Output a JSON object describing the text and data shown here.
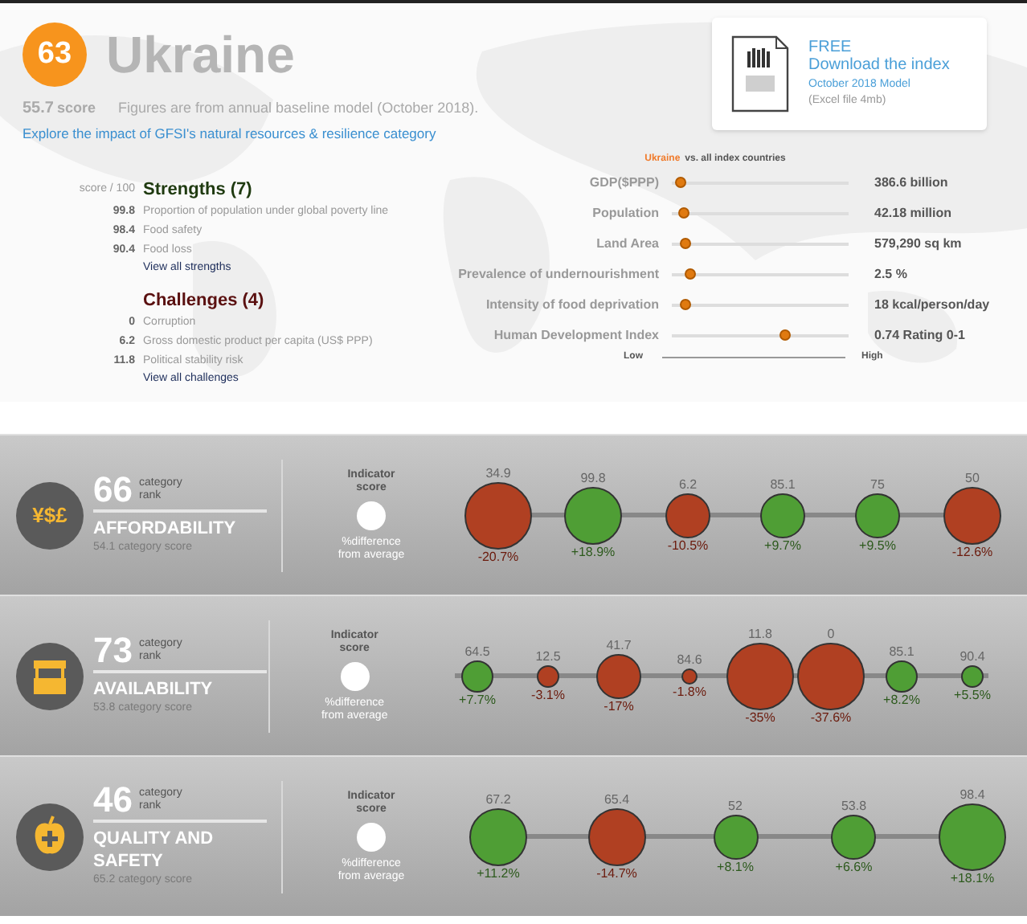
{
  "header": {
    "rank": "63",
    "country": "Ukraine",
    "score": "55.7",
    "score_label": "score",
    "note": "Figures are from annual baseline model (October 2018).",
    "explore_link": "Explore the impact of GFSI's natural resources & resilience category"
  },
  "download": {
    "free": "FREE",
    "title": "Download the index",
    "model": "October 2018 Model",
    "file": "(Excel file 4mb)"
  },
  "strengths": {
    "scale_label": "score / 100",
    "title": "Strengths (7)",
    "items": [
      {
        "score": "99.8",
        "label": "Proportion of population under global poverty line"
      },
      {
        "score": "98.4",
        "label": "Food safety"
      },
      {
        "score": "90.4",
        "label": "Food loss"
      }
    ],
    "link": "View all strengths"
  },
  "challenges": {
    "title": "Challenges (4)",
    "items": [
      {
        "score": "0",
        "label": "Corruption"
      },
      {
        "score": "6.2",
        "label": "Gross domestic product per capita (US$ PPP)"
      },
      {
        "score": "11.8",
        "label": "Political stability risk"
      }
    ],
    "link": "View all challenges"
  },
  "comparison": {
    "legend_country": "Ukraine",
    "legend_rest": "vs. all index countries",
    "rows": [
      {
        "label": "GDP($PPP)",
        "level": 0.02,
        "value": "386.6 billion"
      },
      {
        "label": "Population",
        "level": 0.04,
        "value": "42.18 million"
      },
      {
        "label": "Land Area",
        "level": 0.05,
        "value": "579,290 sq km"
      },
      {
        "label": "Prevalence of undernourishment",
        "level": 0.08,
        "value": "2.5 %"
      },
      {
        "label": "Intensity of food deprivation",
        "level": 0.05,
        "value": "18 kcal/person/day"
      },
      {
        "label": "Human Development Index",
        "level": 0.65,
        "value": "0.74 Rating 0-1"
      }
    ],
    "low": "Low",
    "high": "High"
  },
  "categories": [
    {
      "kind": "currency",
      "glyphs": "¥$£",
      "rank": "66",
      "rank_label": "category rank",
      "name": "AFFORDABILITY",
      "score_text": "54.1 category score",
      "indicator_label": "Indicator score",
      "diff_label": "%difference from average",
      "bubbles": [
        {
          "score": "34.9",
          "diff": "-20.7%",
          "kind": "giant",
          "color": "#b04022"
        },
        {
          "score": "99.8",
          "diff": "+18.9%",
          "kind": "huge",
          "color": "#4f9e35"
        },
        {
          "score": "6.2",
          "diff": "-10.5%",
          "kind": "large",
          "color": "#b04022"
        },
        {
          "score": "85.1",
          "diff": "+9.7%",
          "kind": "large",
          "color": "#4f9e35"
        },
        {
          "score": "75",
          "diff": "+9.5%",
          "kind": "large",
          "color": "#4f9e35"
        },
        {
          "score": "50",
          "diff": "-12.6%",
          "kind": "huge",
          "color": "#b04022"
        }
      ]
    },
    {
      "kind": "stall",
      "rank": "73",
      "rank_label": "category rank",
      "name": "AVAILABILITY",
      "score_text": "53.8 category score",
      "indicator_label": "Indicator score",
      "diff_label": "%difference from average",
      "bubbles": [
        {
          "score": "64.5",
          "diff": "+7.7%",
          "kind": "medium",
          "color": "#4f9e35"
        },
        {
          "score": "12.5",
          "diff": "-3.1%",
          "kind": "small",
          "color": "#b04022"
        },
        {
          "score": "41.7",
          "diff": "-17%",
          "kind": "large",
          "color": "#b04022"
        },
        {
          "score": "84.6",
          "diff": "-1.8%",
          "kind": "tiny",
          "color": "#b04022"
        },
        {
          "score": "11.8",
          "diff": "-35%",
          "kind": "giant",
          "color": "#b04022"
        },
        {
          "score": "0",
          "diff": "-37.6%",
          "kind": "giant",
          "color": "#b04022"
        },
        {
          "score": "85.1",
          "diff": "+8.2%",
          "kind": "medium",
          "color": "#4f9e35"
        },
        {
          "score": "90.4",
          "diff": "+5.5%",
          "kind": "small",
          "color": "#4f9e35"
        }
      ]
    },
    {
      "kind": "apple",
      "rank": "46",
      "rank_label": "category rank",
      "name": "QUALITY AND SAFETY",
      "score_text": "65.2 category score",
      "indicator_label": "Indicator score",
      "diff_label": "%difference from average",
      "bubbles": [
        {
          "score": "67.2",
          "diff": "+11.2%",
          "kind": "huge",
          "color": "#4f9e35"
        },
        {
          "score": "65.4",
          "diff": "-14.7%",
          "kind": "huge",
          "color": "#b04022"
        },
        {
          "score": "52",
          "diff": "+8.1%",
          "kind": "large",
          "color": "#4f9e35"
        },
        {
          "score": "53.8",
          "diff": "+6.6%",
          "kind": "large",
          "color": "#4f9e35"
        },
        {
          "score": "98.4",
          "diff": "+18.1%",
          "kind": "giant",
          "color": "#4f9e35"
        }
      ]
    }
  ]
}
